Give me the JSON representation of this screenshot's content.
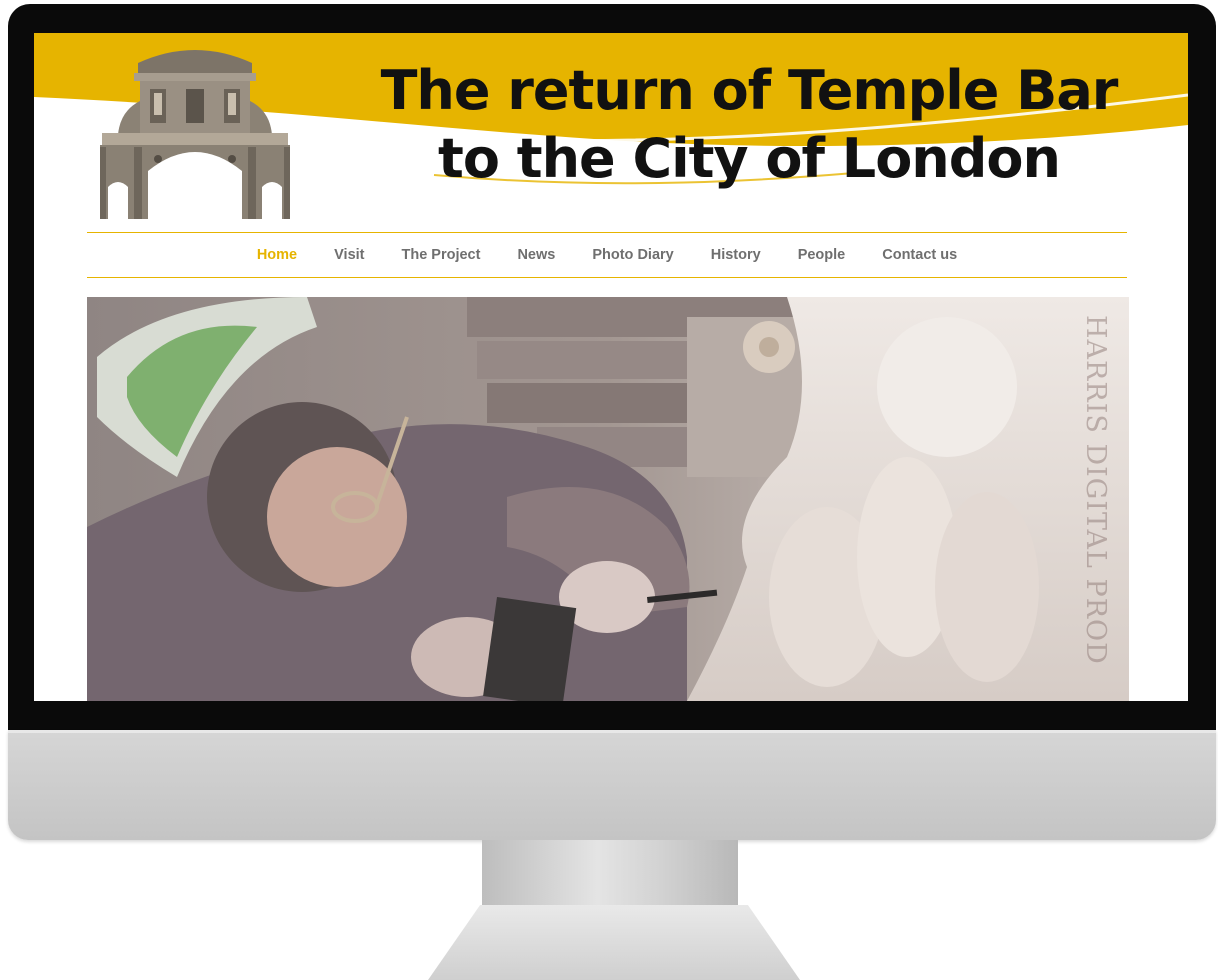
{
  "site": {
    "title": "The return of Temple Bar to the City of London",
    "accent_color": "#e6b400",
    "logo_icon": "temple-bar-gate-icon"
  },
  "nav": {
    "items": [
      {
        "label": "Home",
        "active": true
      },
      {
        "label": "Visit",
        "active": false
      },
      {
        "label": "The Project",
        "active": false
      },
      {
        "label": "News",
        "active": false
      },
      {
        "label": "Photo Diary",
        "active": false
      },
      {
        "label": "History",
        "active": false
      },
      {
        "label": "People",
        "active": false
      },
      {
        "label": "Contact us",
        "active": false
      }
    ]
  },
  "hero": {
    "watermark": "HARRIS DIGITAL PROD"
  }
}
